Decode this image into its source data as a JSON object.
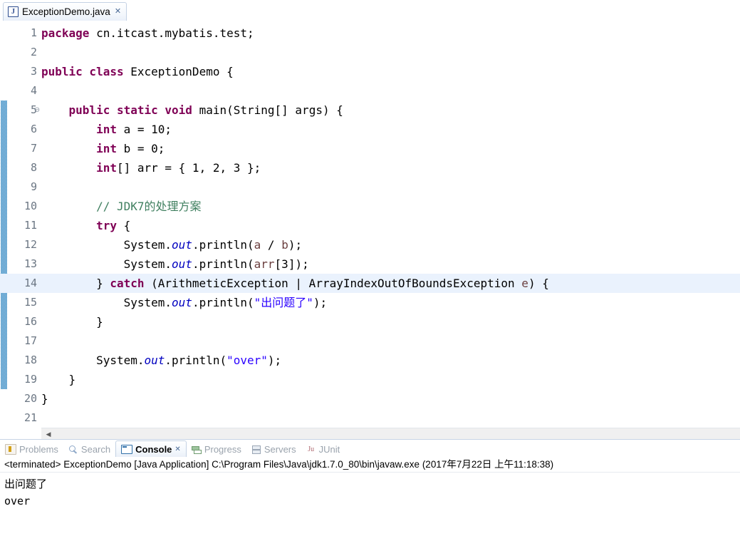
{
  "editor": {
    "tab": {
      "icon": "java-file-icon",
      "title": "ExceptionDemo.java",
      "close": "✕"
    },
    "fold_marker": "⊖",
    "current_line": 14,
    "lines": [
      {
        "num": "1",
        "tokens": [
          {
            "t": "package ",
            "c": "kw"
          },
          {
            "t": "cn.itcast.mybatis.test;",
            "c": "plain"
          }
        ]
      },
      {
        "num": "2",
        "tokens": []
      },
      {
        "num": "3",
        "tokens": [
          {
            "t": "public class ",
            "c": "kw"
          },
          {
            "t": "ExceptionDemo {",
            "c": "plain"
          }
        ]
      },
      {
        "num": "4",
        "tokens": []
      },
      {
        "num": "5",
        "fold": true,
        "tokens": [
          {
            "t": "    ",
            "c": "plain"
          },
          {
            "t": "public static void ",
            "c": "kw"
          },
          {
            "t": "main(String[] args) {",
            "c": "plain"
          }
        ]
      },
      {
        "num": "6",
        "tokens": [
          {
            "t": "        ",
            "c": "plain"
          },
          {
            "t": "int ",
            "c": "kw"
          },
          {
            "t": "a = 10;",
            "c": "plain"
          }
        ]
      },
      {
        "num": "7",
        "tokens": [
          {
            "t": "        ",
            "c": "plain"
          },
          {
            "t": "int ",
            "c": "kw"
          },
          {
            "t": "b = 0;",
            "c": "plain"
          }
        ]
      },
      {
        "num": "8",
        "tokens": [
          {
            "t": "        ",
            "c": "plain"
          },
          {
            "t": "int",
            "c": "kw"
          },
          {
            "t": "[] arr = { 1, 2, 3 };",
            "c": "plain"
          }
        ]
      },
      {
        "num": "9",
        "tokens": []
      },
      {
        "num": "10",
        "tokens": [
          {
            "t": "        ",
            "c": "plain"
          },
          {
            "t": "// JDK7的处理方案",
            "c": "cmt"
          }
        ]
      },
      {
        "num": "11",
        "tokens": [
          {
            "t": "        ",
            "c": "plain"
          },
          {
            "t": "try ",
            "c": "kw"
          },
          {
            "t": "{",
            "c": "plain"
          }
        ]
      },
      {
        "num": "12",
        "tokens": [
          {
            "t": "            System.",
            "c": "plain"
          },
          {
            "t": "out",
            "c": "fld"
          },
          {
            "t": ".println(",
            "c": "plain"
          },
          {
            "t": "a",
            "c": "locvar"
          },
          {
            "t": " / ",
            "c": "plain"
          },
          {
            "t": "b",
            "c": "locvar"
          },
          {
            "t": ");",
            "c": "plain"
          }
        ]
      },
      {
        "num": "13",
        "tokens": [
          {
            "t": "            System.",
            "c": "plain"
          },
          {
            "t": "out",
            "c": "fld"
          },
          {
            "t": ".println(",
            "c": "plain"
          },
          {
            "t": "arr",
            "c": "locvar"
          },
          {
            "t": "[3]);",
            "c": "plain"
          }
        ]
      },
      {
        "num": "14",
        "tokens": [
          {
            "t": "        } ",
            "c": "plain"
          },
          {
            "t": "catch ",
            "c": "kw"
          },
          {
            "t": "(ArithmeticException | ArrayIndexOutOfBoundsException ",
            "c": "plain"
          },
          {
            "t": "e",
            "c": "locvar"
          },
          {
            "t": ") {",
            "c": "plain"
          }
        ]
      },
      {
        "num": "15",
        "tokens": [
          {
            "t": "            System.",
            "c": "plain"
          },
          {
            "t": "out",
            "c": "fld"
          },
          {
            "t": ".println(",
            "c": "plain"
          },
          {
            "t": "\"出问题了\"",
            "c": "str"
          },
          {
            "t": ");",
            "c": "plain"
          }
        ]
      },
      {
        "num": "16",
        "tokens": [
          {
            "t": "        }",
            "c": "plain"
          }
        ]
      },
      {
        "num": "17",
        "tokens": []
      },
      {
        "num": "18",
        "tokens": [
          {
            "t": "        System.",
            "c": "plain"
          },
          {
            "t": "out",
            "c": "fld"
          },
          {
            "t": ".println(",
            "c": "plain"
          },
          {
            "t": "\"over\"",
            "c": "str"
          },
          {
            "t": ");",
            "c": "plain"
          }
        ]
      },
      {
        "num": "19",
        "tokens": [
          {
            "t": "    }",
            "c": "plain"
          }
        ]
      },
      {
        "num": "20",
        "tokens": [
          {
            "t": "}",
            "c": "plain"
          }
        ]
      },
      {
        "num": "21",
        "tokens": []
      }
    ],
    "change_bar": {
      "from_line": 5,
      "to_line": 19
    },
    "hscroll": {
      "left_arrow": "◀"
    }
  },
  "bottom_view": {
    "tabs": [
      {
        "label": "Problems",
        "icon": "problems-icon",
        "icon_class": "ic-problems",
        "active": false
      },
      {
        "label": "Search",
        "icon": "search-icon",
        "icon_class": "ic-search",
        "active": false
      },
      {
        "label": "Console",
        "icon": "console-icon",
        "icon_class": "ic-console",
        "active": true,
        "close": "✕"
      },
      {
        "label": "Progress",
        "icon": "progress-icon",
        "icon_class": "ic-progress",
        "active": false
      },
      {
        "label": "Servers",
        "icon": "servers-icon",
        "icon_class": "ic-servers",
        "active": false
      },
      {
        "label": "JUnit",
        "icon": "junit-icon",
        "icon_class": "ic-junit",
        "active": false
      }
    ],
    "console": {
      "header": "<terminated> ExceptionDemo [Java Application] C:\\Program Files\\Java\\jdk1.7.0_80\\bin\\javaw.exe (2017年7月22日 上午11:18:38)",
      "output": [
        "出问题了",
        "over"
      ]
    }
  },
  "colors": {
    "keyword": "#7f0055",
    "string": "#2a00ff",
    "comment": "#3f7f5f",
    "field": "#0000c0",
    "local_variable": "#6a3e3e",
    "current_line_highlight": "#eaf2fd",
    "change_bar": "#3c8dc5"
  }
}
